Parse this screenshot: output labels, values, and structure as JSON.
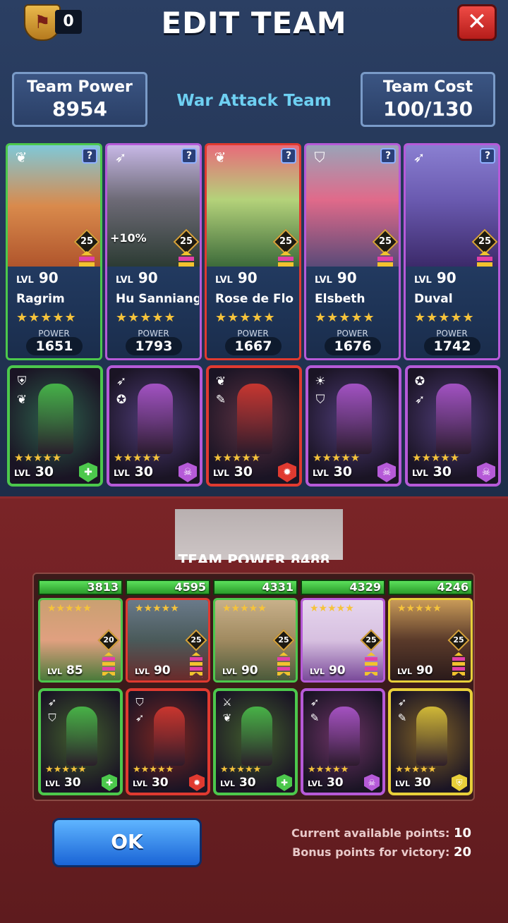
{
  "header": {
    "banner_count": "0",
    "title": "EDIT TEAM",
    "close_label": "✕"
  },
  "stats": {
    "team_power_label": "Team Power",
    "team_power_value": "8954",
    "team_name": "War Attack Team",
    "team_cost_label": "Team Cost",
    "team_cost_value": "100/130"
  },
  "heroes": [
    {
      "name": "Ragrim",
      "level": "90",
      "limit": "25",
      "power": "1651",
      "power_label": "POWER",
      "color": "#4cc84c",
      "bonus": ""
    },
    {
      "name": "Hu Sanniang",
      "level": "90",
      "limit": "25",
      "power": "1793",
      "power_label": "POWER",
      "color": "#b65ad8",
      "bonus": "+10%"
    },
    {
      "name": "Rose de Flo",
      "level": "90",
      "limit": "25",
      "power": "1667",
      "power_label": "POWER",
      "color": "#e03a30",
      "bonus": ""
    },
    {
      "name": "Elsbeth",
      "level": "90",
      "limit": "25",
      "power": "1676",
      "power_label": "POWER",
      "color": "#b65ad8",
      "bonus": ""
    },
    {
      "name": "Duval",
      "level": "90",
      "limit": "25",
      "power": "1742",
      "power_label": "POWER",
      "color": "#b65ad8",
      "bonus": ""
    }
  ],
  "troops": [
    {
      "level": "30",
      "color": "#4cc84c"
    },
    {
      "level": "30",
      "color": "#b65ad8"
    },
    {
      "level": "30",
      "color": "#e03a30"
    },
    {
      "level": "30",
      "color": "#b65ad8"
    },
    {
      "level": "30",
      "color": "#b65ad8"
    }
  ],
  "enemy": {
    "team_power_partial": "TEAM POWER 8488",
    "powers": [
      "3813",
      "4595",
      "4331",
      "4329",
      "4246"
    ],
    "heroes": [
      {
        "level": "85",
        "limit": "20",
        "color": "#4cc84c"
      },
      {
        "level": "90",
        "limit": "25",
        "color": "#e03a30"
      },
      {
        "level": "90",
        "limit": "25",
        "color": "#4cc84c"
      },
      {
        "level": "90",
        "limit": "25",
        "color": "#b65ad8"
      },
      {
        "level": "90",
        "limit": "25",
        "color": "#e8cf3a"
      }
    ],
    "troops": [
      {
        "level": "30",
        "color": "#4cc84c"
      },
      {
        "level": "30",
        "color": "#e03a30"
      },
      {
        "level": "30",
        "color": "#4cc84c"
      },
      {
        "level": "30",
        "color": "#b65ad8"
      },
      {
        "level": "30",
        "color": "#e8cf3a"
      }
    ]
  },
  "footer": {
    "ok_label": "OK",
    "available_label": "Current available points:",
    "available_value": "10",
    "bonus_label": "Bonus points for victory:",
    "bonus_value": "20"
  },
  "common": {
    "lvl_label": "LVL",
    "five_stars": "★★★★★",
    "help": "?"
  }
}
